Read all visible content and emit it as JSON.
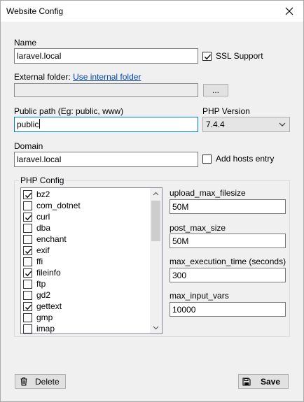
{
  "window": {
    "title": "Website Config"
  },
  "name": {
    "label": "Name",
    "value": "laravel.local"
  },
  "ssl": {
    "label": "SSL Support",
    "checked": true
  },
  "external_folder": {
    "label": "External folder:",
    "link": "Use internal folder",
    "value": "",
    "browse_label": "..."
  },
  "public_path": {
    "label": "Public path (Eg: public, www)",
    "value": "public"
  },
  "php_version": {
    "label": "PHP Version",
    "selected": "7.4.4"
  },
  "domain": {
    "label": "Domain",
    "value": "laravel.local"
  },
  "hosts": {
    "label": "Add hosts entry",
    "checked": false
  },
  "php_config": {
    "label": "PHP Config",
    "extensions": [
      {
        "name": "bz2",
        "checked": true
      },
      {
        "name": "com_dotnet",
        "checked": false
      },
      {
        "name": "curl",
        "checked": true
      },
      {
        "name": "dba",
        "checked": false
      },
      {
        "name": "enchant",
        "checked": false
      },
      {
        "name": "exif",
        "checked": true
      },
      {
        "name": "ffi",
        "checked": false
      },
      {
        "name": "fileinfo",
        "checked": true
      },
      {
        "name": "ftp",
        "checked": false
      },
      {
        "name": "gd2",
        "checked": false
      },
      {
        "name": "gettext",
        "checked": true
      },
      {
        "name": "gmp",
        "checked": false
      },
      {
        "name": "imap",
        "checked": false
      }
    ],
    "scroll_position": 0,
    "fields": [
      {
        "label": "upload_max_filesize",
        "value": "50M"
      },
      {
        "label": "post_max_size",
        "value": "50M"
      },
      {
        "label": "max_execution_time (seconds)",
        "value": "300"
      },
      {
        "label": "max_input_vars",
        "value": "10000"
      }
    ]
  },
  "buttons": {
    "delete": "Delete",
    "save": "Save"
  },
  "icons": {
    "close": "close-icon",
    "delete": "trash-icon",
    "save": "floppy-disk-icon",
    "dropdown": "chevron-down-icon"
  }
}
